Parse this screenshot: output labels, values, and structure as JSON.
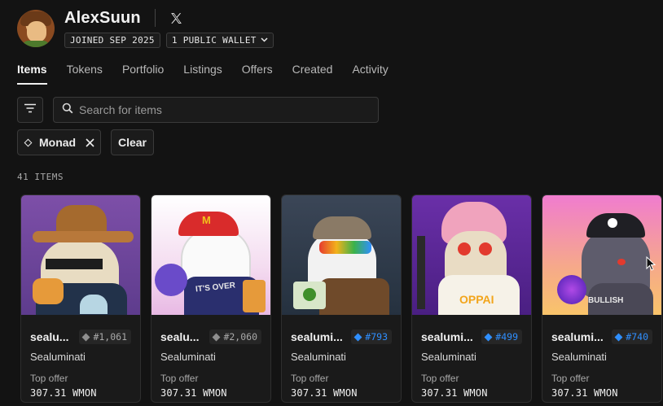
{
  "profile": {
    "username": "AlexSuun",
    "joined": "JOINED SEP 2025",
    "wallets": "1 PUBLIC WALLET"
  },
  "tabs": [
    {
      "label": "Items",
      "active": true
    },
    {
      "label": "Tokens"
    },
    {
      "label": "Portfolio"
    },
    {
      "label": "Listings"
    },
    {
      "label": "Offers"
    },
    {
      "label": "Created"
    },
    {
      "label": "Activity"
    }
  ],
  "search": {
    "placeholder": "Search for items"
  },
  "filters": {
    "monad_label": "Monad",
    "clear_label": "Clear"
  },
  "items_count": "41 ITEMS",
  "colors": {
    "accent_blue": "#2f8fff",
    "muted": "#a9a9a9"
  },
  "cards": [
    {
      "name": "sealu...",
      "token": "#1,061",
      "collection": "Sealuminati",
      "offer_label": "Top offer",
      "offer_value": "307.31 WMON",
      "highlight": false
    },
    {
      "name": "sealu...",
      "token": "#2,060",
      "collection": "Sealuminati",
      "offer_label": "Top offer",
      "offer_value": "307.31 WMON",
      "highlight": false
    },
    {
      "name": "sealumi...",
      "token": "#793",
      "collection": "Sealuminati",
      "offer_label": "Top offer",
      "offer_value": "307.31 WMON",
      "highlight": true
    },
    {
      "name": "sealumi...",
      "token": "#499",
      "collection": "Sealuminati",
      "offer_label": "Top offer",
      "offer_value": "307.31 WMON",
      "highlight": true
    },
    {
      "name": "sealumi...",
      "token": "#740",
      "collection": "Sealuminati",
      "offer_label": "Top offer",
      "offer_value": "307.31 WMON",
      "highlight": true
    }
  ],
  "art_text": {
    "card2_shirt": "IT'S OVER",
    "card4_shirt": "OPPAI",
    "card5_chain": "BULLISH"
  }
}
